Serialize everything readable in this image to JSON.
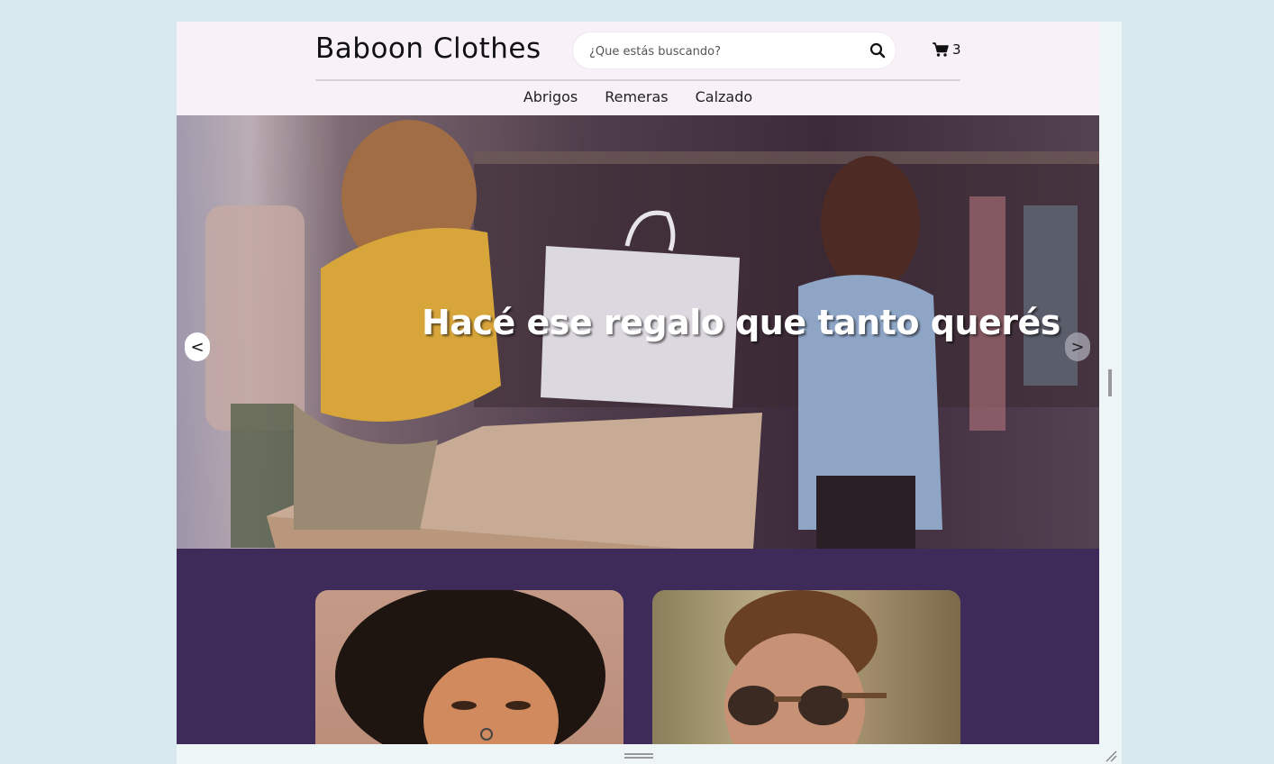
{
  "brand": {
    "name": "Baboon Clothes"
  },
  "search": {
    "placeholder": "¿Que estás buscando?",
    "value": ""
  },
  "cart": {
    "count": "3"
  },
  "nav": {
    "items": [
      "Abrigos",
      "Remeras",
      "Calzado"
    ]
  },
  "hero": {
    "title": "Hacé ese regalo que tanto querés",
    "prev_label": "<",
    "next_label": ">"
  },
  "colors": {
    "header_bg": "#f9f1f8",
    "products_bg": "#3f2b5a",
    "page_bg": "#d7e9ee"
  },
  "icons": [
    "search-icon",
    "cart-icon"
  ]
}
